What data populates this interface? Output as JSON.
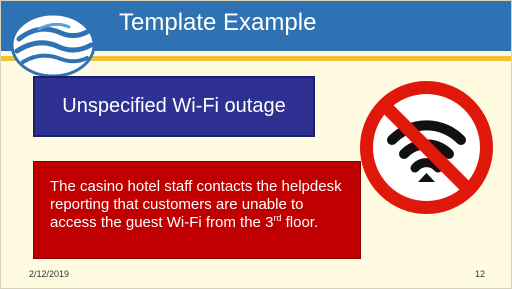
{
  "slide": {
    "title": "Template Example",
    "label": "Unspecified Wi-Fi outage",
    "description": {
      "before_sup": "The casino hotel staff contacts the helpdesk reporting that customers are unable to access the guest Wi-Fi from the 3",
      "sup": "rd",
      "after_sup": " floor."
    },
    "footer": {
      "date": "2/12/2019",
      "page": "12"
    }
  },
  "icons": {
    "logo": "wave-logo-icon",
    "no_wifi": "no-wifi-icon"
  },
  "colors": {
    "title_bar": "#2f72b4",
    "accent_rule": "#f0c23a",
    "slide_background": "#fffbe0",
    "label_box": "#2e3192",
    "description_box": "#c00000",
    "prohibition_red": "#e0180c"
  }
}
